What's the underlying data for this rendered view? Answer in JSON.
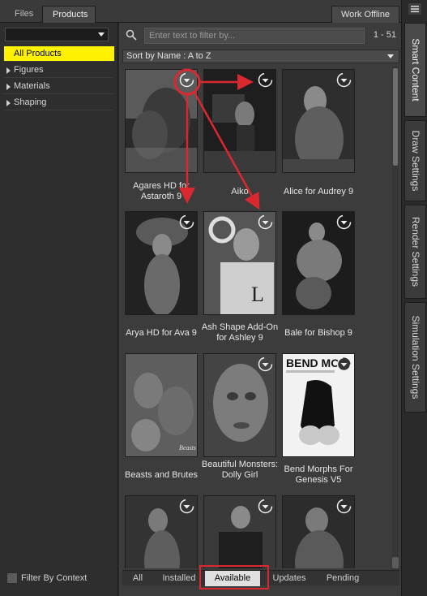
{
  "top_tabs": {
    "files": "Files",
    "products": "Products",
    "work_offline": "Work Offline"
  },
  "categories": [
    {
      "label": "All Products",
      "selected": true
    },
    {
      "label": "Figures"
    },
    {
      "label": "Materials"
    },
    {
      "label": "Shaping"
    }
  ],
  "filter_by_context": "Filter By Context",
  "search": {
    "placeholder": "Enter text to filter by...",
    "count": "1 - 51"
  },
  "sort": "Sort by Name : A to Z",
  "products": [
    {
      "name": "Agares HD for Astaroth 9",
      "icon": "agares-thumbnail"
    },
    {
      "name": "Aiko",
      "icon": "aiko-thumbnail"
    },
    {
      "name": "Alice for Audrey 9",
      "icon": "alice-thumbnail"
    },
    {
      "name": "Arya HD for Ava 9",
      "icon": "arya-thumbnail"
    },
    {
      "name": "Ash Shape Add-On for Ashley 9",
      "icon": "ash-thumbnail"
    },
    {
      "name": "Bale for Bishop 9",
      "icon": "bale-thumbnail"
    },
    {
      "name": "Beasts and Brutes",
      "icon": "beasts-thumbnail"
    },
    {
      "name": "Beautiful Monsters: Dolly Girl",
      "icon": "dolly-thumbnail"
    },
    {
      "name": "Bend Morphs For Genesis V5",
      "icon": "bend-morphs-thumbnail"
    },
    {
      "name": "",
      "icon": "row4-thumbnail-1"
    },
    {
      "name": "",
      "icon": "row4-thumbnail-2"
    },
    {
      "name": "",
      "icon": "row4-thumbnail-3"
    }
  ],
  "bottom_tabs": [
    "All",
    "Installed",
    "Available",
    "Updates",
    "Pending"
  ],
  "active_bottom_tab": "Available",
  "side_tabs": [
    "Smart Content",
    "Draw Settings",
    "Render Settings",
    "Simulation Settings"
  ],
  "colors": {
    "selection": "#fff200",
    "annotation": "#d9282f"
  }
}
